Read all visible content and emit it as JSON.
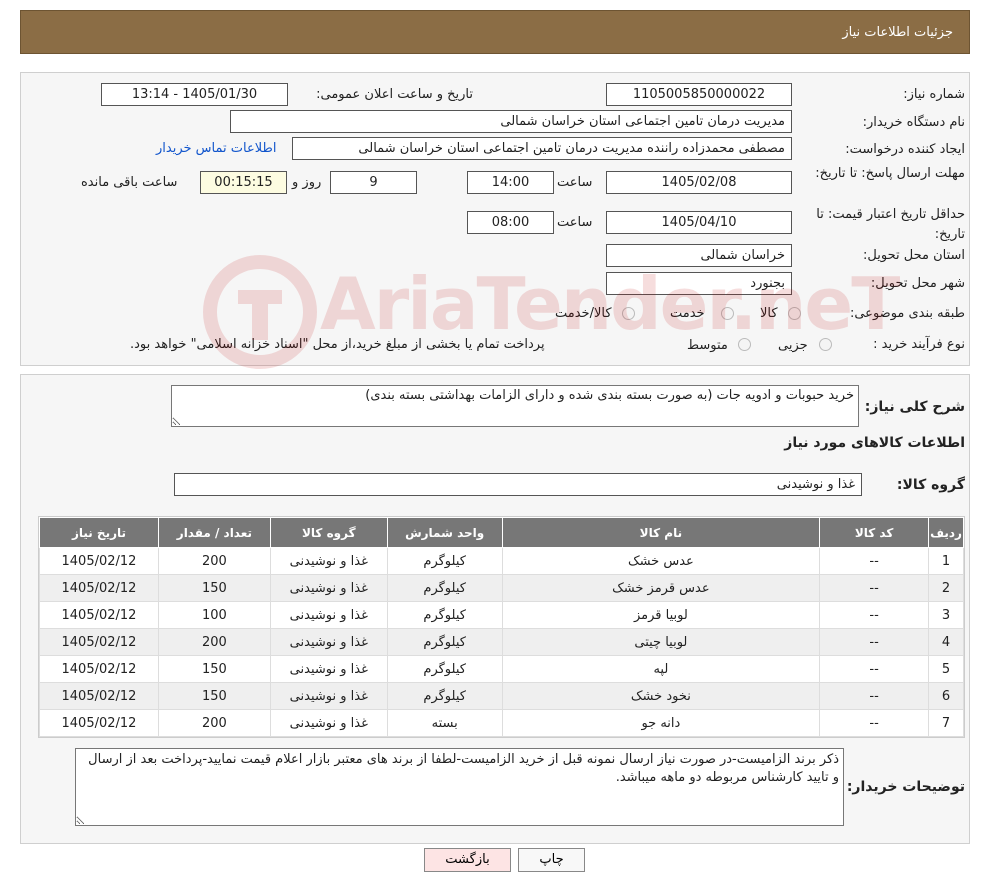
{
  "header": {
    "title": "جزئیات اطلاعات نیاز"
  },
  "info": {
    "need_number_label": "شماره نیاز:",
    "need_number": "1105005850000022",
    "announce_label": "تاریخ و ساعت اعلان عمومی:",
    "announce_value": "1405/01/30 - 13:14",
    "buyer_label": "نام دستگاه خریدار:",
    "buyer_value": "مدیریت درمان تامین اجتماعی استان خراسان شمالی",
    "creator_label": "ایجاد کننده درخواست:",
    "creator_value": "مصطفی محمدزاده راننده مدیریت درمان تامین اجتماعی استان خراسان شمالی",
    "contact_link": "اطلاعات تماس خریدار",
    "deadline_label": "مهلت ارسال پاسخ: تا تاریخ:",
    "deadline_date": "1405/02/08",
    "time_label": "ساعت",
    "deadline_time": "14:00",
    "days_value": "9",
    "days_label": "روز و",
    "remaining_value": "00:15:15",
    "remaining_label": "ساعت باقی مانده",
    "validity_label": "حداقل تاریخ اعتبار قیمت: تا تاریخ:",
    "validity_date": "1405/04/10",
    "validity_time": "08:00",
    "province_label": "استان محل تحویل:",
    "province_value": "خراسان شمالی",
    "city_label": "شهر محل تحویل:",
    "city_value": "بجنورد",
    "category_label": "طبقه بندی موضوعی:",
    "category_options": [
      "کالا",
      "خدمت",
      "کالا/خدمت"
    ],
    "process_label": "نوع فرآیند خرید :",
    "process_options": [
      "جزیی",
      "متوسط"
    ],
    "process_note": "پرداخت تمام یا بخشی از مبلغ خرید،از محل \"اسناد خزانه اسلامی\" خواهد بود."
  },
  "description": {
    "label": "شرح کلی نیاز:",
    "value": "خرید حبوبات و ادویه جات (به صورت بسته بندی شده و دارای الزامات بهداشتی بسته بندی)"
  },
  "goods": {
    "section_title": "اطلاعات کالاهای مورد نیاز",
    "group_label": "گروه کالا:",
    "group_value": "غذا و نوشیدنی",
    "columns": [
      "ردیف",
      "کد کالا",
      "نام کالا",
      "واحد شمارش",
      "گروه کالا",
      "تعداد / مقدار",
      "تاریخ نیاز"
    ],
    "rows": [
      [
        "1",
        "--",
        "عدس خشک",
        "کیلوگرم",
        "غذا و نوشیدنی",
        "200",
        "1405/02/12"
      ],
      [
        "2",
        "--",
        "عدس قرمز خشک",
        "کیلوگرم",
        "غذا و نوشیدنی",
        "150",
        "1405/02/12"
      ],
      [
        "3",
        "--",
        "لوبیا قرمز",
        "کیلوگرم",
        "غذا و نوشیدنی",
        "100",
        "1405/02/12"
      ],
      [
        "4",
        "--",
        "لوبیا چیتی",
        "کیلوگرم",
        "غذا و نوشیدنی",
        "200",
        "1405/02/12"
      ],
      [
        "5",
        "--",
        "لپه",
        "کیلوگرم",
        "غذا و نوشیدنی",
        "150",
        "1405/02/12"
      ],
      [
        "6",
        "--",
        "نخود خشک",
        "کیلوگرم",
        "غذا و نوشیدنی",
        "150",
        "1405/02/12"
      ],
      [
        "7",
        "--",
        "دانه جو",
        "بسته",
        "غذا و نوشیدنی",
        "200",
        "1405/02/12"
      ]
    ]
  },
  "buyer_notes": {
    "label": "توضیحات خریدار:",
    "value": "ذکر برند الزامیست-در صورت نیاز ارسال نمونه قبل از خرید الزامیست-لطفا از برند های معتبر بازار اعلام قیمت نمایید-پرداخت بعد از ارسال و تایید کارشناس مربوطه دو ماهه میباشد."
  },
  "buttons": {
    "print": "چاپ",
    "back": "بازگشت"
  },
  "watermark": {
    "text": "AriaTender.neT"
  },
  "colors": {
    "header_bg": "#8b6d45",
    "link": "#1155cc",
    "table_header": "#777777",
    "back_button": "#fde4e4"
  }
}
